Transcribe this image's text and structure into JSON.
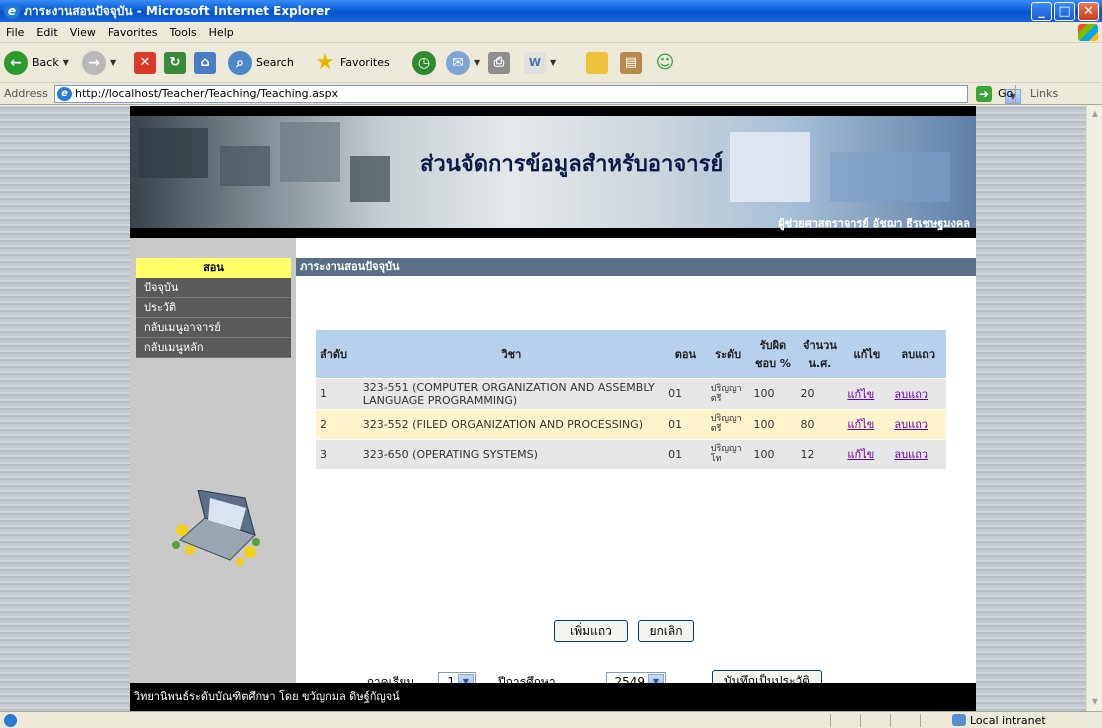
{
  "window": {
    "title": "ภาระงานสอนปัจจุบัน - Microsoft Internet Explorer"
  },
  "menu": [
    "File",
    "Edit",
    "View",
    "Favorites",
    "Tools",
    "Help"
  ],
  "toolbar": {
    "back": "Back",
    "search": "Search",
    "favorites": "Favorites"
  },
  "address": {
    "label": "Address",
    "url": "http://localhost/Teacher/Teaching/Teaching.aspx",
    "go": "Go",
    "links": "Links"
  },
  "banner": {
    "title": "ส่วนจัดการข้อมูลสำหรับอาจารย์",
    "user": "ผู้ช่วยศาสตราจารย์ อัชฌา ธีรเชษฐมงคล"
  },
  "sidebar": {
    "header": "สอน",
    "items": [
      "ปัจจุบัน",
      "ประวัติ",
      "กลับเมนูอาจารย์",
      "กลับเมนูหลัก"
    ]
  },
  "content": {
    "header": "ภาระงานสอนปัจจุบัน",
    "columns": [
      "ลำดับ",
      "วิชา",
      "ตอน",
      "ระดับ",
      "รับผิดชอบ %",
      "จำนวน น.ศ.",
      "แก้ไข",
      "ลบแถว"
    ],
    "rows": [
      {
        "no": "1",
        "course": "323-551 (COMPUTER ORGANIZATION AND ASSEMBLY LANGUAGE PROGRAMMING)",
        "section": "01",
        "level": "ปริญญาตรี",
        "percent": "100",
        "students": "20",
        "edit": "แก้ไข",
        "delete": "ลบแถว"
      },
      {
        "no": "2",
        "course": "323-552 (FILED ORGANIZATION AND PROCESSING)",
        "section": "01",
        "level": "ปริญญาตรี",
        "percent": "100",
        "students": "80",
        "edit": "แก้ไข",
        "delete": "ลบแถว"
      },
      {
        "no": "3",
        "course": "323-650 (OPERATING SYSTEMS)",
        "section": "01",
        "level": "ปริญญาโท",
        "percent": "100",
        "students": "12",
        "edit": "แก้ไข",
        "delete": "ลบแถว"
      }
    ],
    "add_button": "เพิ่มแถว",
    "cancel_button": "ยกเลิก",
    "semester_label": "ภาคเรียน",
    "semester_value": "1",
    "year_label": "ปีการศึกษา",
    "year_value": "2549",
    "save_history_button": "บันทึกเป็นประวัติ"
  },
  "footer": {
    "text": "วิทยานิพนธ์ระดับบัณฑิตศึกษา โดย ขวัญกมล ดิษฐ์กัญจน์"
  },
  "status": {
    "zone": "Local intranet"
  }
}
